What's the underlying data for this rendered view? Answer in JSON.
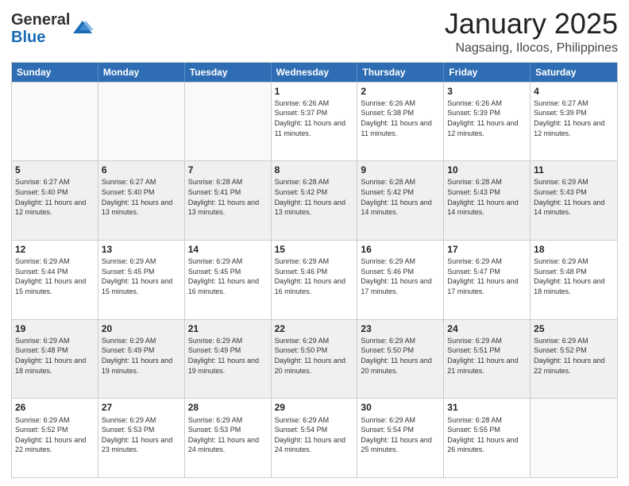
{
  "logo": {
    "general": "General",
    "blue": "Blue"
  },
  "header": {
    "title": "January 2025",
    "subtitle": "Nagsaing, Ilocos, Philippines"
  },
  "weekdays": [
    "Sunday",
    "Monday",
    "Tuesday",
    "Wednesday",
    "Thursday",
    "Friday",
    "Saturday"
  ],
  "weeks": [
    [
      {
        "day": "",
        "sunrise": "",
        "sunset": "",
        "daylight": "",
        "shaded": false,
        "empty": true
      },
      {
        "day": "",
        "sunrise": "",
        "sunset": "",
        "daylight": "",
        "shaded": false,
        "empty": true
      },
      {
        "day": "",
        "sunrise": "",
        "sunset": "",
        "daylight": "",
        "shaded": false,
        "empty": true
      },
      {
        "day": "1",
        "sunrise": "Sunrise: 6:26 AM",
        "sunset": "Sunset: 5:37 PM",
        "daylight": "Daylight: 11 hours and 11 minutes.",
        "shaded": false,
        "empty": false
      },
      {
        "day": "2",
        "sunrise": "Sunrise: 6:26 AM",
        "sunset": "Sunset: 5:38 PM",
        "daylight": "Daylight: 11 hours and 11 minutes.",
        "shaded": false,
        "empty": false
      },
      {
        "day": "3",
        "sunrise": "Sunrise: 6:26 AM",
        "sunset": "Sunset: 5:39 PM",
        "daylight": "Daylight: 11 hours and 12 minutes.",
        "shaded": false,
        "empty": false
      },
      {
        "day": "4",
        "sunrise": "Sunrise: 6:27 AM",
        "sunset": "Sunset: 5:39 PM",
        "daylight": "Daylight: 11 hours and 12 minutes.",
        "shaded": false,
        "empty": false
      }
    ],
    [
      {
        "day": "5",
        "sunrise": "Sunrise: 6:27 AM",
        "sunset": "Sunset: 5:40 PM",
        "daylight": "Daylight: 11 hours and 12 minutes.",
        "shaded": true,
        "empty": false
      },
      {
        "day": "6",
        "sunrise": "Sunrise: 6:27 AM",
        "sunset": "Sunset: 5:40 PM",
        "daylight": "Daylight: 11 hours and 13 minutes.",
        "shaded": true,
        "empty": false
      },
      {
        "day": "7",
        "sunrise": "Sunrise: 6:28 AM",
        "sunset": "Sunset: 5:41 PM",
        "daylight": "Daylight: 11 hours and 13 minutes.",
        "shaded": true,
        "empty": false
      },
      {
        "day": "8",
        "sunrise": "Sunrise: 6:28 AM",
        "sunset": "Sunset: 5:42 PM",
        "daylight": "Daylight: 11 hours and 13 minutes.",
        "shaded": true,
        "empty": false
      },
      {
        "day": "9",
        "sunrise": "Sunrise: 6:28 AM",
        "sunset": "Sunset: 5:42 PM",
        "daylight": "Daylight: 11 hours and 14 minutes.",
        "shaded": true,
        "empty": false
      },
      {
        "day": "10",
        "sunrise": "Sunrise: 6:28 AM",
        "sunset": "Sunset: 5:43 PM",
        "daylight": "Daylight: 11 hours and 14 minutes.",
        "shaded": true,
        "empty": false
      },
      {
        "day": "11",
        "sunrise": "Sunrise: 6:29 AM",
        "sunset": "Sunset: 5:43 PM",
        "daylight": "Daylight: 11 hours and 14 minutes.",
        "shaded": true,
        "empty": false
      }
    ],
    [
      {
        "day": "12",
        "sunrise": "Sunrise: 6:29 AM",
        "sunset": "Sunset: 5:44 PM",
        "daylight": "Daylight: 11 hours and 15 minutes.",
        "shaded": false,
        "empty": false
      },
      {
        "day": "13",
        "sunrise": "Sunrise: 6:29 AM",
        "sunset": "Sunset: 5:45 PM",
        "daylight": "Daylight: 11 hours and 15 minutes.",
        "shaded": false,
        "empty": false
      },
      {
        "day": "14",
        "sunrise": "Sunrise: 6:29 AM",
        "sunset": "Sunset: 5:45 PM",
        "daylight": "Daylight: 11 hours and 16 minutes.",
        "shaded": false,
        "empty": false
      },
      {
        "day": "15",
        "sunrise": "Sunrise: 6:29 AM",
        "sunset": "Sunset: 5:46 PM",
        "daylight": "Daylight: 11 hours and 16 minutes.",
        "shaded": false,
        "empty": false
      },
      {
        "day": "16",
        "sunrise": "Sunrise: 6:29 AM",
        "sunset": "Sunset: 5:46 PM",
        "daylight": "Daylight: 11 hours and 17 minutes.",
        "shaded": false,
        "empty": false
      },
      {
        "day": "17",
        "sunrise": "Sunrise: 6:29 AM",
        "sunset": "Sunset: 5:47 PM",
        "daylight": "Daylight: 11 hours and 17 minutes.",
        "shaded": false,
        "empty": false
      },
      {
        "day": "18",
        "sunrise": "Sunrise: 6:29 AM",
        "sunset": "Sunset: 5:48 PM",
        "daylight": "Daylight: 11 hours and 18 minutes.",
        "shaded": false,
        "empty": false
      }
    ],
    [
      {
        "day": "19",
        "sunrise": "Sunrise: 6:29 AM",
        "sunset": "Sunset: 5:48 PM",
        "daylight": "Daylight: 11 hours and 18 minutes.",
        "shaded": true,
        "empty": false
      },
      {
        "day": "20",
        "sunrise": "Sunrise: 6:29 AM",
        "sunset": "Sunset: 5:49 PM",
        "daylight": "Daylight: 11 hours and 19 minutes.",
        "shaded": true,
        "empty": false
      },
      {
        "day": "21",
        "sunrise": "Sunrise: 6:29 AM",
        "sunset": "Sunset: 5:49 PM",
        "daylight": "Daylight: 11 hours and 19 minutes.",
        "shaded": true,
        "empty": false
      },
      {
        "day": "22",
        "sunrise": "Sunrise: 6:29 AM",
        "sunset": "Sunset: 5:50 PM",
        "daylight": "Daylight: 11 hours and 20 minutes.",
        "shaded": true,
        "empty": false
      },
      {
        "day": "23",
        "sunrise": "Sunrise: 6:29 AM",
        "sunset": "Sunset: 5:50 PM",
        "daylight": "Daylight: 11 hours and 20 minutes.",
        "shaded": true,
        "empty": false
      },
      {
        "day": "24",
        "sunrise": "Sunrise: 6:29 AM",
        "sunset": "Sunset: 5:51 PM",
        "daylight": "Daylight: 11 hours and 21 minutes.",
        "shaded": true,
        "empty": false
      },
      {
        "day": "25",
        "sunrise": "Sunrise: 6:29 AM",
        "sunset": "Sunset: 5:52 PM",
        "daylight": "Daylight: 11 hours and 22 minutes.",
        "shaded": true,
        "empty": false
      }
    ],
    [
      {
        "day": "26",
        "sunrise": "Sunrise: 6:29 AM",
        "sunset": "Sunset: 5:52 PM",
        "daylight": "Daylight: 11 hours and 22 minutes.",
        "shaded": false,
        "empty": false
      },
      {
        "day": "27",
        "sunrise": "Sunrise: 6:29 AM",
        "sunset": "Sunset: 5:53 PM",
        "daylight": "Daylight: 11 hours and 23 minutes.",
        "shaded": false,
        "empty": false
      },
      {
        "day": "28",
        "sunrise": "Sunrise: 6:29 AM",
        "sunset": "Sunset: 5:53 PM",
        "daylight": "Daylight: 11 hours and 24 minutes.",
        "shaded": false,
        "empty": false
      },
      {
        "day": "29",
        "sunrise": "Sunrise: 6:29 AM",
        "sunset": "Sunset: 5:54 PM",
        "daylight": "Daylight: 11 hours and 24 minutes.",
        "shaded": false,
        "empty": false
      },
      {
        "day": "30",
        "sunrise": "Sunrise: 6:29 AM",
        "sunset": "Sunset: 5:54 PM",
        "daylight": "Daylight: 11 hours and 25 minutes.",
        "shaded": false,
        "empty": false
      },
      {
        "day": "31",
        "sunrise": "Sunrise: 6:28 AM",
        "sunset": "Sunset: 5:55 PM",
        "daylight": "Daylight: 11 hours and 26 minutes.",
        "shaded": false,
        "empty": false
      },
      {
        "day": "",
        "sunrise": "",
        "sunset": "",
        "daylight": "",
        "shaded": false,
        "empty": true
      }
    ]
  ]
}
